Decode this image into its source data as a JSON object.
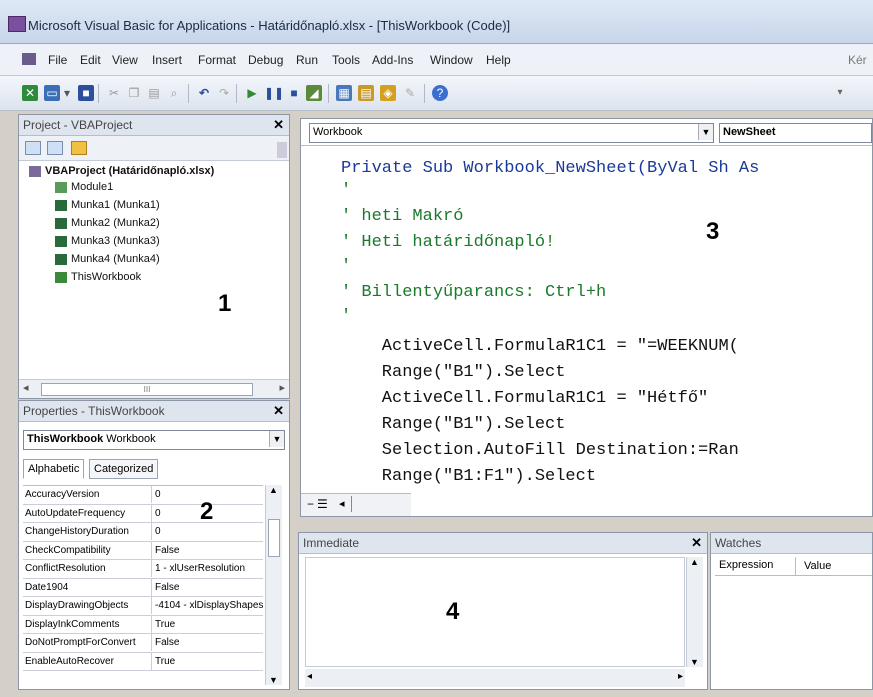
{
  "window": {
    "title": "Microsoft Visual Basic for Applications - Határidőnapló.xlsx - [ThisWorkbook (Code)]"
  },
  "menu": {
    "items": [
      "File",
      "Edit",
      "View",
      "Insert",
      "Format",
      "Debug",
      "Run",
      "Tools",
      "Add-Ins",
      "Window",
      "Help"
    ],
    "right_text": "Kér"
  },
  "project": {
    "title": "Project - VBAProject",
    "root": "VBAProject (Határidőnapló.xlsx)",
    "items": [
      "Module1",
      "Munka1 (Munka1)",
      "Munka2 (Munka2)",
      "Munka3 (Munka3)",
      "Munka4 (Munka4)",
      "ThisWorkbook"
    ],
    "scroll_mid": "III"
  },
  "properties": {
    "title": "Properties - ThisWorkbook",
    "object_bold": "ThisWorkbook",
    "object_type": "Workbook",
    "tabs": [
      "Alphabetic",
      "Categorized"
    ],
    "rows": [
      {
        "name": "AccuracyVersion",
        "value": "0"
      },
      {
        "name": "AutoUpdateFrequency",
        "value": "0"
      },
      {
        "name": "ChangeHistoryDuration",
        "value": "0"
      },
      {
        "name": "CheckCompatibility",
        "value": "False"
      },
      {
        "name": "ConflictResolution",
        "value": "1 - xlUserResolution"
      },
      {
        "name": "Date1904",
        "value": "False"
      },
      {
        "name": "DisplayDrawingObjects",
        "value": "-4104 - xlDisplayShapes"
      },
      {
        "name": "DisplayInkComments",
        "value": "True"
      },
      {
        "name": "DoNotPromptForConvert",
        "value": "False"
      },
      {
        "name": "EnableAutoRecover",
        "value": "True"
      }
    ]
  },
  "code": {
    "object_combo": "Workbook",
    "proc_combo": "NewSheet",
    "lines": [
      "Private Sub Workbook_NewSheet(ByVal Sh As",
      "'",
      "' heti Makró",
      "' Heti határidőnapló!",
      "'",
      "' Billentyűparancs: Ctrl+h",
      "'",
      "    ActiveCell.FormulaR1C1 = \"=WEEKNUM(",
      "    Range(\"B1\").Select",
      "    ActiveCell.FormulaR1C1 = \"Hétfő\"",
      "    Range(\"B1\").Select",
      "    Selection.AutoFill Destination:=Ran",
      "    Range(\"B1:F1\").Select"
    ]
  },
  "immediate": {
    "title": "Immediate"
  },
  "watches": {
    "title": "Watches",
    "columns": [
      "Expression",
      "Value"
    ]
  },
  "annotations": [
    "1",
    "2",
    "3",
    "4"
  ]
}
